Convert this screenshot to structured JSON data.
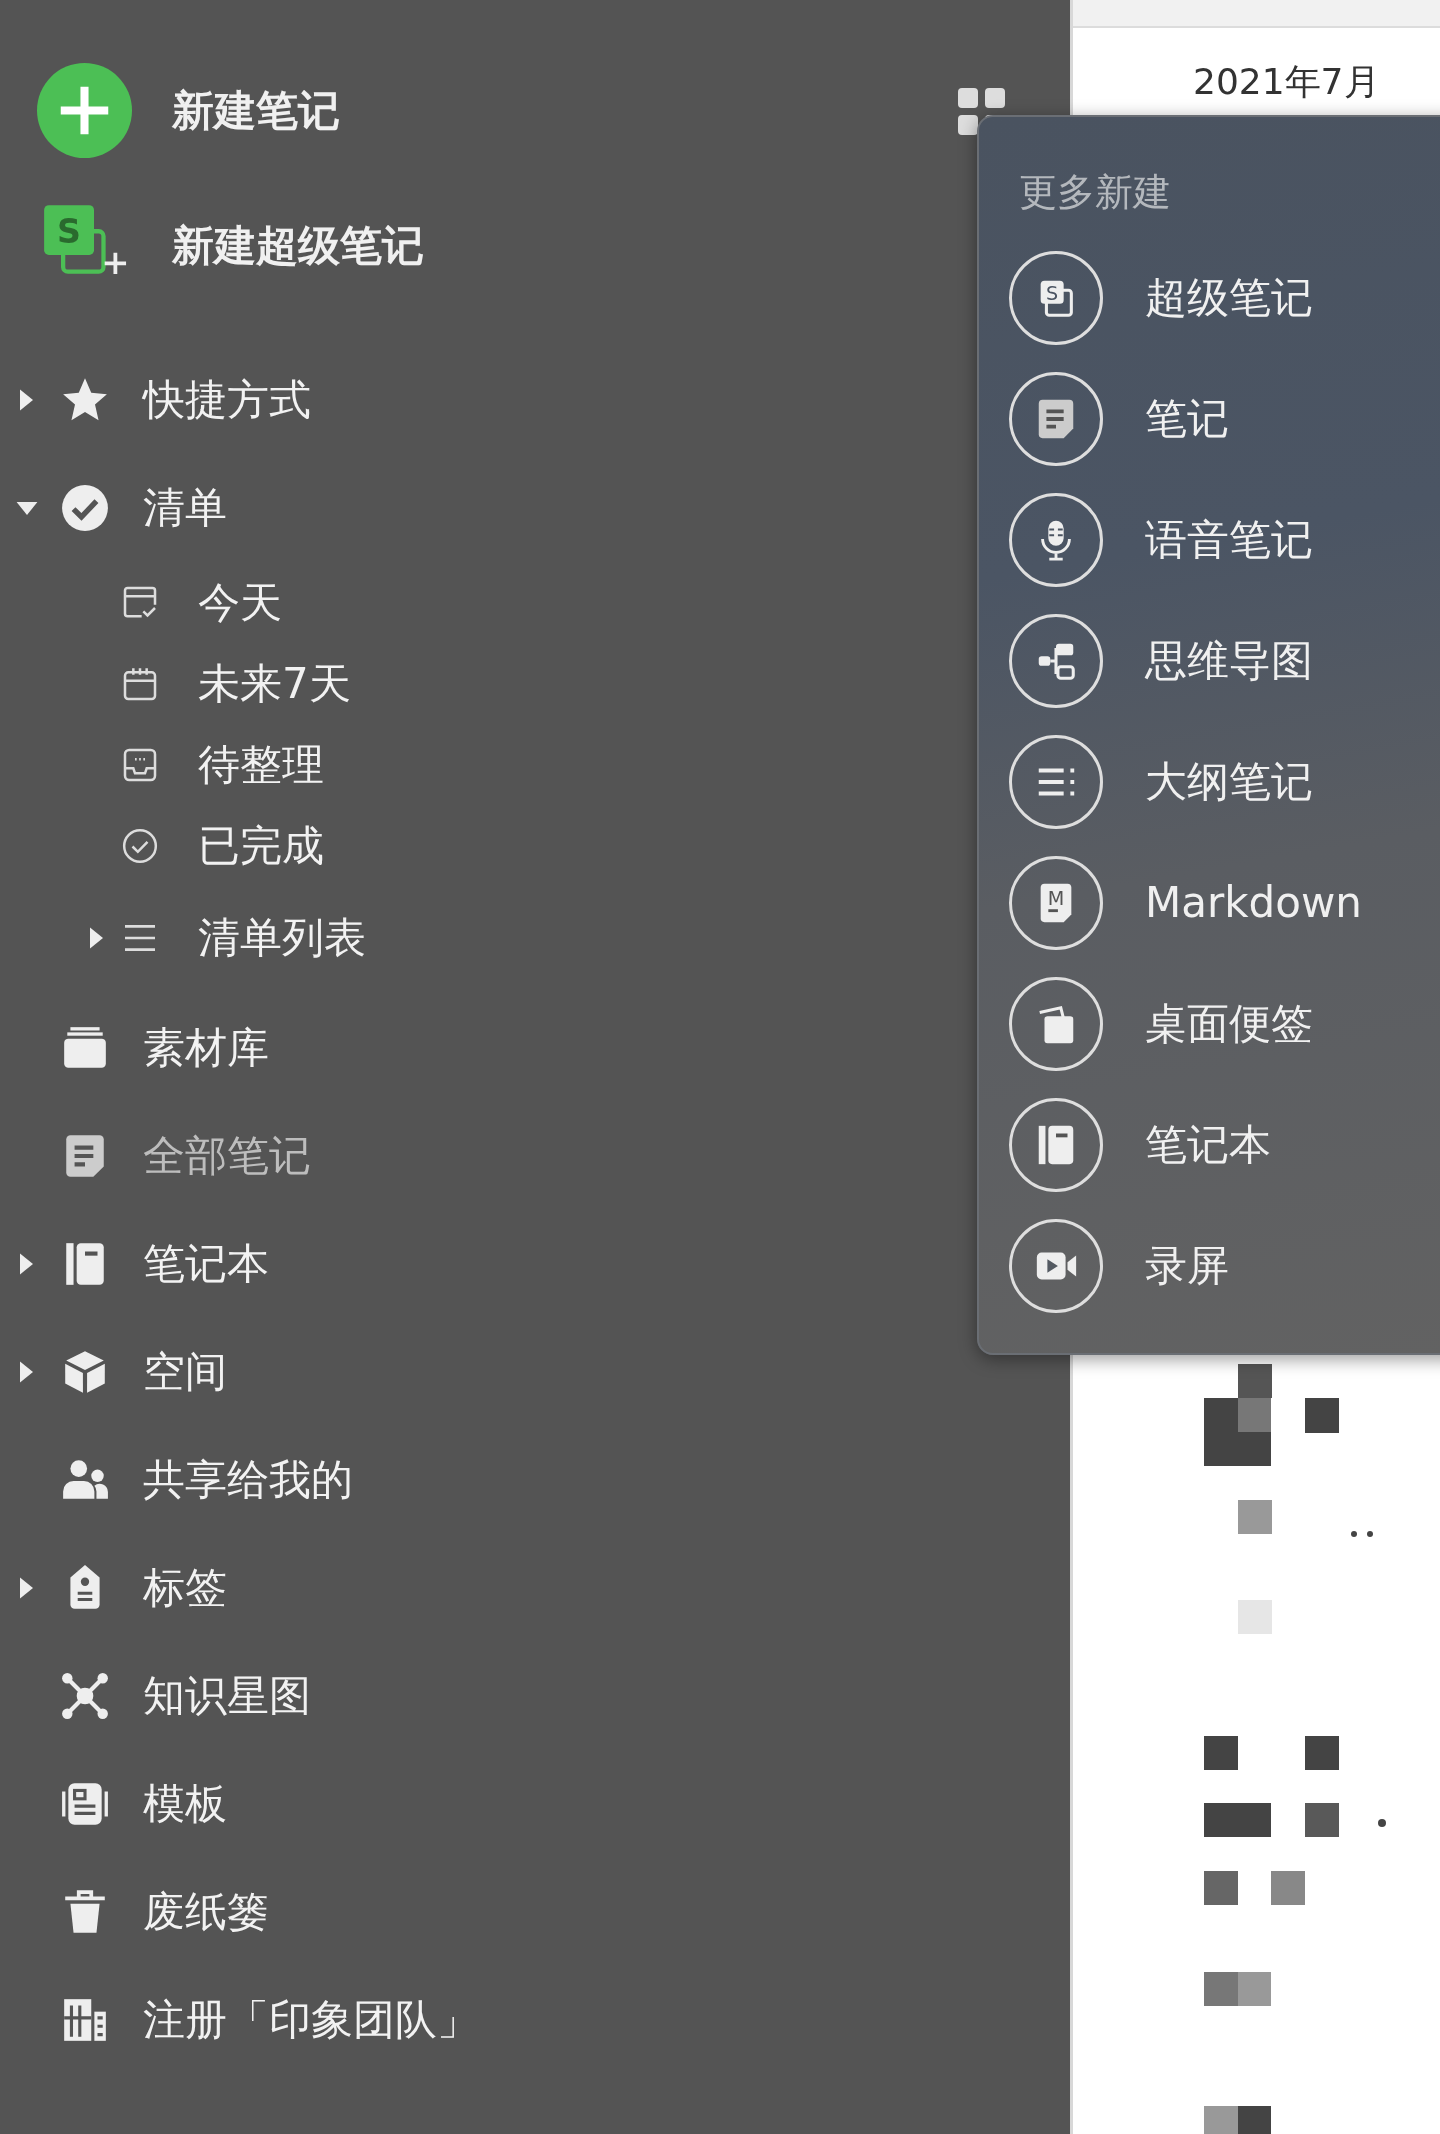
{
  "actions": [
    {
      "kind": "plus",
      "label": "新建笔记"
    },
    {
      "kind": "super",
      "label": "新建超级笔记",
      "badge": "S"
    }
  ],
  "tree": [
    {
      "label": "快捷方式",
      "expanded": false,
      "dimmed": false
    },
    {
      "label": "清单",
      "expanded": true,
      "dimmed": false,
      "children": [
        {
          "label": "今天",
          "dimmed": false
        },
        {
          "label": "未来7天",
          "dimmed": false
        },
        {
          "label": "待整理",
          "dimmed": false
        },
        {
          "label": "已完成",
          "dimmed": false
        },
        {
          "label": "清单列表",
          "expanded": false,
          "dimmed": false
        }
      ]
    },
    {
      "label": "素材库",
      "dimmed": false
    },
    {
      "label": "全部笔记",
      "dimmed": true
    },
    {
      "label": "笔记本",
      "expanded": false,
      "dimmed": false
    },
    {
      "label": "空间",
      "expanded": false,
      "dimmed": false
    },
    {
      "label": "共享给我的",
      "dimmed": false
    },
    {
      "label": "标签",
      "expanded": false,
      "dimmed": false
    },
    {
      "label": "知识星图",
      "dimmed": false
    },
    {
      "label": "模板",
      "dimmed": false
    },
    {
      "label": "废纸篓",
      "dimmed": false
    },
    {
      "label": "注册「印象团队」",
      "dimmed": false
    }
  ],
  "menu": {
    "title": "更多新建",
    "items": [
      {
        "label": "超级笔记",
        "badge": "S"
      },
      {
        "label": "笔记"
      },
      {
        "label": "语音笔记"
      },
      {
        "label": "思维导图"
      },
      {
        "label": "大纲笔记"
      },
      {
        "label": "Markdown",
        "badge": "M"
      },
      {
        "label": "桌面便签"
      },
      {
        "label": "笔记本"
      },
      {
        "label": "录屏"
      }
    ]
  },
  "panel": {
    "heading": "2021年7月"
  }
}
